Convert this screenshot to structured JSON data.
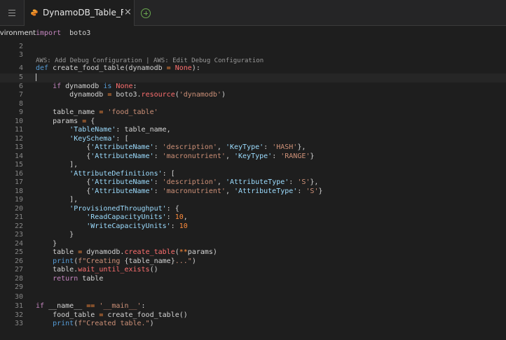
{
  "tab": {
    "title": "DynamoDB_Table_Fu",
    "close": "×"
  },
  "sidebar": {
    "env_label": "Environment"
  },
  "codelens": "AWS: Add Debug Configuration | AWS: Edit Debug Configuration",
  "lines": [
    {
      "n": "",
      "segs": [
        [
          "kw",
          "import"
        ],
        [
          "",
          "  boto3"
        ]
      ]
    },
    {
      "n": "2",
      "segs": []
    },
    {
      "n": "3",
      "segs": []
    },
    {
      "n": "4",
      "segs": [
        [
          "def",
          "def "
        ],
        [
          "",
          "create_food_table(dynamodb "
        ],
        [
          "op",
          "="
        ],
        [
          "none",
          " None"
        ],
        [
          "",
          "):"
        ]
      ]
    },
    {
      "n": "5",
      "segs": [],
      "current": true
    },
    {
      "n": "6",
      "segs": [
        [
          "",
          "    "
        ],
        [
          "kw",
          "if"
        ],
        [
          "",
          " dynamodb "
        ],
        [
          "kb",
          "is"
        ],
        [
          "none",
          " None"
        ],
        [
          "",
          ":"
        ]
      ]
    },
    {
      "n": "7",
      "segs": [
        [
          "",
          "        dynamodb "
        ],
        [
          "op",
          "="
        ],
        [
          "",
          " boto3."
        ],
        [
          "fn",
          "resource"
        ],
        [
          "",
          "("
        ],
        [
          "str",
          "'dynamodb'"
        ],
        [
          "",
          ")"
        ]
      ]
    },
    {
      "n": "8",
      "segs": []
    },
    {
      "n": "9",
      "segs": [
        [
          "",
          "    table_name "
        ],
        [
          "op",
          "="
        ],
        [
          "str",
          " 'food_table'"
        ]
      ]
    },
    {
      "n": "10",
      "segs": [
        [
          "",
          "    params "
        ],
        [
          "op",
          "="
        ],
        [
          "",
          " {"
        ]
      ]
    },
    {
      "n": "11",
      "segs": [
        [
          "",
          "        "
        ],
        [
          "key",
          "'TableName'"
        ],
        [
          "",
          ": table_name,"
        ]
      ]
    },
    {
      "n": "12",
      "segs": [
        [
          "",
          "        "
        ],
        [
          "key",
          "'KeySchema'"
        ],
        [
          "",
          ": ["
        ]
      ]
    },
    {
      "n": "13",
      "segs": [
        [
          "",
          "            {"
        ],
        [
          "key",
          "'AttributeName'"
        ],
        [
          "",
          ": "
        ],
        [
          "str",
          "'description'"
        ],
        [
          "",
          ", "
        ],
        [
          "key",
          "'KeyType'"
        ],
        [
          "",
          ": "
        ],
        [
          "str",
          "'HASH'"
        ],
        [
          "",
          "},"
        ]
      ]
    },
    {
      "n": "14",
      "segs": [
        [
          "",
          "            {"
        ],
        [
          "key",
          "'AttributeName'"
        ],
        [
          "",
          ": "
        ],
        [
          "str",
          "'macronutrient'"
        ],
        [
          "",
          ", "
        ],
        [
          "key",
          "'KeyType'"
        ],
        [
          "",
          ": "
        ],
        [
          "str",
          "'RANGE'"
        ],
        [
          "",
          "}"
        ]
      ]
    },
    {
      "n": "15",
      "segs": [
        [
          "",
          "        ],"
        ]
      ]
    },
    {
      "n": "16",
      "segs": [
        [
          "",
          "        "
        ],
        [
          "key",
          "'AttributeDefinitions'"
        ],
        [
          "",
          ": ["
        ]
      ]
    },
    {
      "n": "17",
      "segs": [
        [
          "",
          "            {"
        ],
        [
          "key",
          "'AttributeName'"
        ],
        [
          "",
          ": "
        ],
        [
          "str",
          "'description'"
        ],
        [
          "",
          ", "
        ],
        [
          "key",
          "'AttributeType'"
        ],
        [
          "",
          ": "
        ],
        [
          "str",
          "'S'"
        ],
        [
          "",
          "},"
        ]
      ]
    },
    {
      "n": "18",
      "segs": [
        [
          "",
          "            {"
        ],
        [
          "key",
          "'AttributeName'"
        ],
        [
          "",
          ": "
        ],
        [
          "str",
          "'macronutrient'"
        ],
        [
          "",
          ", "
        ],
        [
          "key",
          "'AttributeType'"
        ],
        [
          "",
          ": "
        ],
        [
          "str",
          "'S'"
        ],
        [
          "",
          "}"
        ]
      ]
    },
    {
      "n": "19",
      "segs": [
        [
          "",
          "        ],"
        ]
      ]
    },
    {
      "n": "20",
      "segs": [
        [
          "",
          "        "
        ],
        [
          "key",
          "'ProvisionedThroughput'"
        ],
        [
          "",
          ": {"
        ]
      ]
    },
    {
      "n": "21",
      "segs": [
        [
          "",
          "            "
        ],
        [
          "key",
          "'ReadCapacityUnits'"
        ],
        [
          "",
          ": "
        ],
        [
          "num",
          "10"
        ],
        [
          "",
          ","
        ]
      ]
    },
    {
      "n": "22",
      "segs": [
        [
          "",
          "            "
        ],
        [
          "key",
          "'WriteCapacityUnits'"
        ],
        [
          "",
          ": "
        ],
        [
          "num",
          "10"
        ]
      ]
    },
    {
      "n": "23",
      "segs": [
        [
          "",
          "        }"
        ]
      ]
    },
    {
      "n": "24",
      "segs": [
        [
          "",
          "    }"
        ]
      ]
    },
    {
      "n": "25",
      "segs": [
        [
          "",
          "    table "
        ],
        [
          "op",
          "="
        ],
        [
          "",
          " dynamodb."
        ],
        [
          "fn",
          "create_table"
        ],
        [
          "",
          "("
        ],
        [
          "op",
          "**"
        ],
        [
          "",
          "params)"
        ]
      ]
    },
    {
      "n": "26",
      "segs": [
        [
          "",
          "    "
        ],
        [
          "kb",
          "print"
        ],
        [
          "",
          "("
        ],
        [
          "str",
          "f\"Creating "
        ],
        [
          "",
          "{table_name}"
        ],
        [
          "str",
          "...\""
        ],
        [
          "",
          ")"
        ]
      ]
    },
    {
      "n": "27",
      "segs": [
        [
          "",
          "    table."
        ],
        [
          "fn",
          "wait_until_exists"
        ],
        [
          "",
          "()"
        ]
      ]
    },
    {
      "n": "28",
      "segs": [
        [
          "",
          "    "
        ],
        [
          "kw",
          "return"
        ],
        [
          "",
          " table"
        ]
      ]
    },
    {
      "n": "29",
      "segs": []
    },
    {
      "n": "30",
      "segs": []
    },
    {
      "n": "31",
      "segs": [
        [
          "kw",
          "if"
        ],
        [
          "",
          " __name__ "
        ],
        [
          "op",
          "=="
        ],
        [
          "str",
          " '__main__'"
        ],
        [
          "",
          ":"
        ]
      ]
    },
    {
      "n": "32",
      "segs": [
        [
          "",
          "    food_table "
        ],
        [
          "op",
          "="
        ],
        [
          "",
          " create_food_table()"
        ]
      ]
    },
    {
      "n": "33",
      "segs": [
        [
          "",
          "    "
        ],
        [
          "kb",
          "print"
        ],
        [
          "",
          "("
        ],
        [
          "str",
          "f\"Created table.\""
        ],
        [
          "",
          ")"
        ]
      ]
    }
  ]
}
